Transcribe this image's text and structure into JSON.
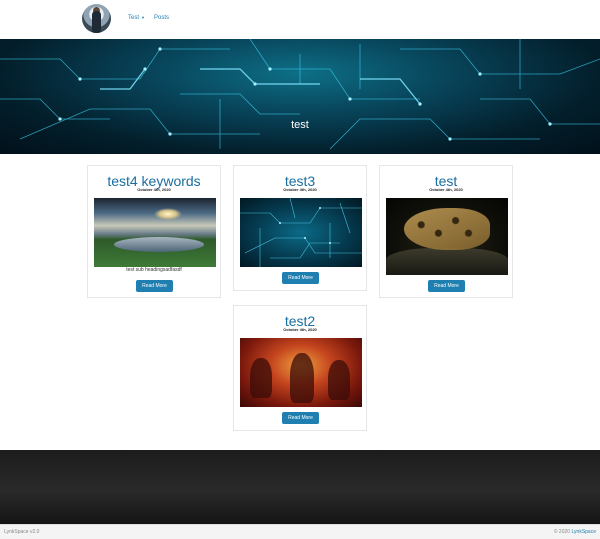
{
  "nav": {
    "items": [
      {
        "label": "Test",
        "has_dropdown": true
      },
      {
        "label": "Posts",
        "has_dropdown": false
      }
    ]
  },
  "hero": {
    "title": "test"
  },
  "posts": [
    {
      "title": "test4 keywords",
      "date": "October 4th, 2020",
      "subheading": "test sub headingsadfasdf",
      "button": "Read More",
      "image": "landscape-photo"
    },
    {
      "title": "test3",
      "date": "October 4th, 2020",
      "subheading": "",
      "button": "Read More",
      "image": "circuit-photo"
    },
    {
      "title": "test",
      "date": "October 4th, 2020",
      "subheading": "",
      "button": "Read More",
      "image": "leopard-photo"
    },
    {
      "title": "test2",
      "date": "October 4th, 2020",
      "subheading": "",
      "button": "Read More",
      "image": "doom-art"
    }
  ],
  "footer": {
    "version": "LynkSpace v2.0",
    "copyright": "© 2020 ",
    "brand_link": "LynkSpace"
  },
  "colors": {
    "accent": "#1f7fb0",
    "title": "#1a6ea0"
  }
}
